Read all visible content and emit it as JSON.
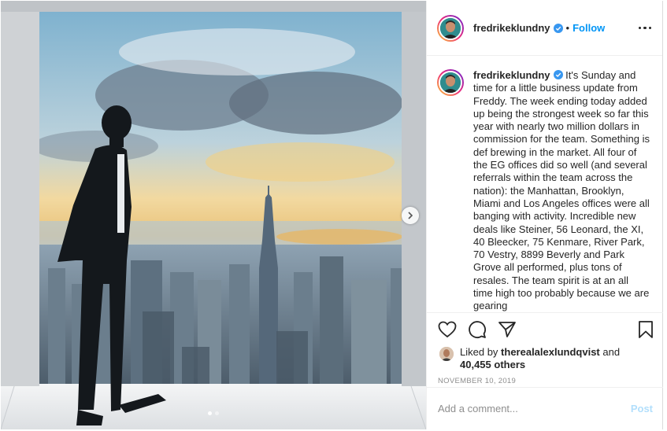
{
  "post": {
    "username": "fredrikeklundny",
    "verified": true,
    "follow_separator": "•",
    "follow_label": "Follow",
    "more_icon": "more-options-icon",
    "caption_text": "It's Sunday and time for a little business update from Freddy. The week ending today added up being the strongest week so far this year with nearly two million dollars in commission for the team. Something is def brewing in the market. All four of the EG offices did so well (and several referrals within the team across the nation): the Manhattan, Brooklyn, Miami and Los Angeles offices were all banging with activity. Incredible new deals like Steiner, 56 Leonard, the XI, 40 Bleecker, 75 Kenmare, River Park, 70 Vestry, 8899 Beverly and Park Grove all performed, plus tons of resales. The team spirit is at an all time high too probably because we are gearing",
    "liked_by_prefix": "Liked by ",
    "liked_by_user": "therealalexlundqvist",
    "liked_by_and": " and",
    "likes_count": "40,455 others",
    "date": "NOVEMBER 10, 2019",
    "comment_placeholder": "Add a comment...",
    "post_button": "Post"
  },
  "carousel": {
    "slides": 2,
    "active": 1
  },
  "colors": {
    "accent": "#0095f6",
    "post_disabled": "#b2dffc",
    "verified": "#3897f0"
  }
}
